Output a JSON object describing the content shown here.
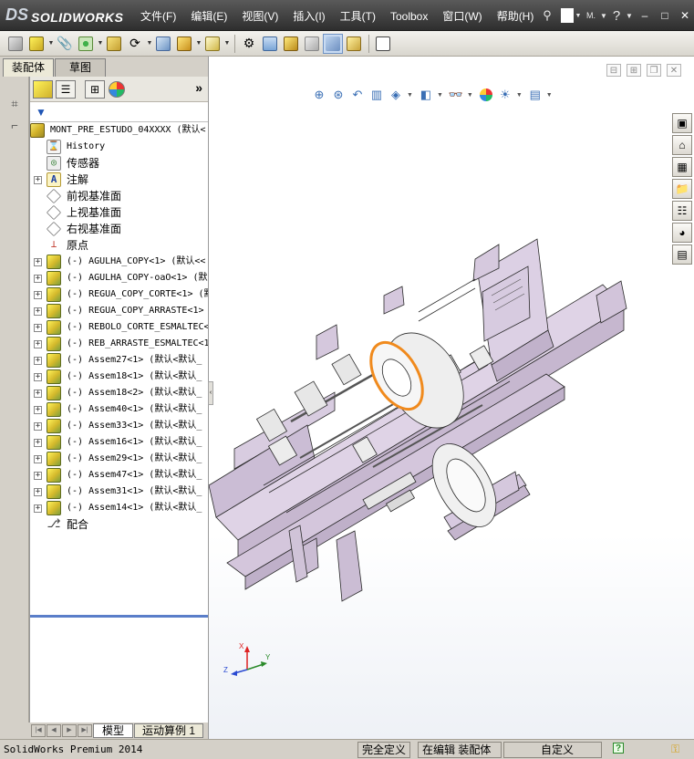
{
  "app": {
    "brand_prefix": "DS",
    "brand": "SOLIDWORKS"
  },
  "menu": [
    "文件(F)",
    "编辑(E)",
    "视图(V)",
    "插入(I)",
    "工具(T)",
    "Toolbox",
    "窗口(W)",
    "帮助(H)"
  ],
  "title_tools": {
    "pin": "pin-icon",
    "new_doc_label": "",
    "search_hint": "M.",
    "help": "?"
  },
  "featuremanager": {
    "tabs": {
      "assembly": "装配体",
      "sketch": "草图"
    },
    "more": "»",
    "tree": [
      {
        "type": "asm",
        "label": "MONT_PRE_ESTUDO_04XXXX  (默认<",
        "expand": false,
        "indent": 0
      },
      {
        "type": "hist",
        "label": "History",
        "expand": false,
        "indent": 1
      },
      {
        "type": "sens",
        "label": "传感器",
        "expand": false,
        "indent": 1,
        "cn": true
      },
      {
        "type": "ann",
        "label": "注解",
        "expand": true,
        "indent": 1,
        "cn": true
      },
      {
        "type": "plane",
        "label": "前视基准面",
        "expand": false,
        "indent": 1,
        "cn": true
      },
      {
        "type": "plane",
        "label": "上视基准面",
        "expand": false,
        "indent": 1,
        "cn": true
      },
      {
        "type": "plane",
        "label": "右视基准面",
        "expand": false,
        "indent": 1,
        "cn": true
      },
      {
        "type": "origin",
        "label": "原点",
        "expand": false,
        "indent": 1,
        "cn": true
      },
      {
        "type": "part",
        "label": "(-) AGULHA_COPY<1> (默认<<",
        "expand": true,
        "indent": 1
      },
      {
        "type": "part",
        "label": "(-) AGULHA_COPY-oaO<1> (默认",
        "expand": true,
        "indent": 1
      },
      {
        "type": "part",
        "label": "(-) REGUA_COPY_CORTE<1> (默",
        "expand": true,
        "indent": 1
      },
      {
        "type": "part",
        "label": "(-) REGUA_COPY_ARRASTE<1>",
        "expand": true,
        "indent": 1
      },
      {
        "type": "part",
        "label": "(-) REBOLO_CORTE_ESMALTEC<",
        "expand": true,
        "indent": 1
      },
      {
        "type": "part",
        "label": "(-) REB_ARRASTE_ESMALTEC<1",
        "expand": true,
        "indent": 1
      },
      {
        "type": "part",
        "label": "(-) Assem27<1> (默认<默认_",
        "expand": true,
        "indent": 1
      },
      {
        "type": "part",
        "label": "(-) Assem18<1> (默认<默认_",
        "expand": true,
        "indent": 1
      },
      {
        "type": "part",
        "label": "(-) Assem18<2> (默认<默认_",
        "expand": true,
        "indent": 1
      },
      {
        "type": "part",
        "label": "(-) Assem40<1> (默认<默认_",
        "expand": true,
        "indent": 1
      },
      {
        "type": "part",
        "label": "(-) Assem33<1> (默认<默认_",
        "expand": true,
        "indent": 1
      },
      {
        "type": "part",
        "label": "(-) Assem16<1> (默认<默认_",
        "expand": true,
        "indent": 1
      },
      {
        "type": "part",
        "label": "(-) Assem29<1> (默认<默认_",
        "expand": true,
        "indent": 1
      },
      {
        "type": "part",
        "label": "(-) Assem47<1> (默认<默认_",
        "expand": true,
        "indent": 1
      },
      {
        "type": "part",
        "label": "(-) Assem31<1> (默认<默认_",
        "expand": true,
        "indent": 1
      },
      {
        "type": "part",
        "label": "(-) Assem14<1> (默认<默认_",
        "expand": true,
        "indent": 1
      },
      {
        "type": "mate",
        "label": "配合",
        "expand": false,
        "indent": 1,
        "cn": true
      }
    ]
  },
  "model_tabs": {
    "model": "模型",
    "motion": "运动算例 1"
  },
  "status": {
    "product": "SolidWorks Premium 2014",
    "defined": "完全定义",
    "editing": "在编辑 装配体",
    "custom": "自定义"
  },
  "triad": {
    "x": "X",
    "y": "Y",
    "z": "Z"
  },
  "colors": {
    "part_body": "#d9cde0",
    "part_edge": "#2a2a2a",
    "selection": "#f08a1d",
    "titlebar": "#3d3d3d"
  }
}
